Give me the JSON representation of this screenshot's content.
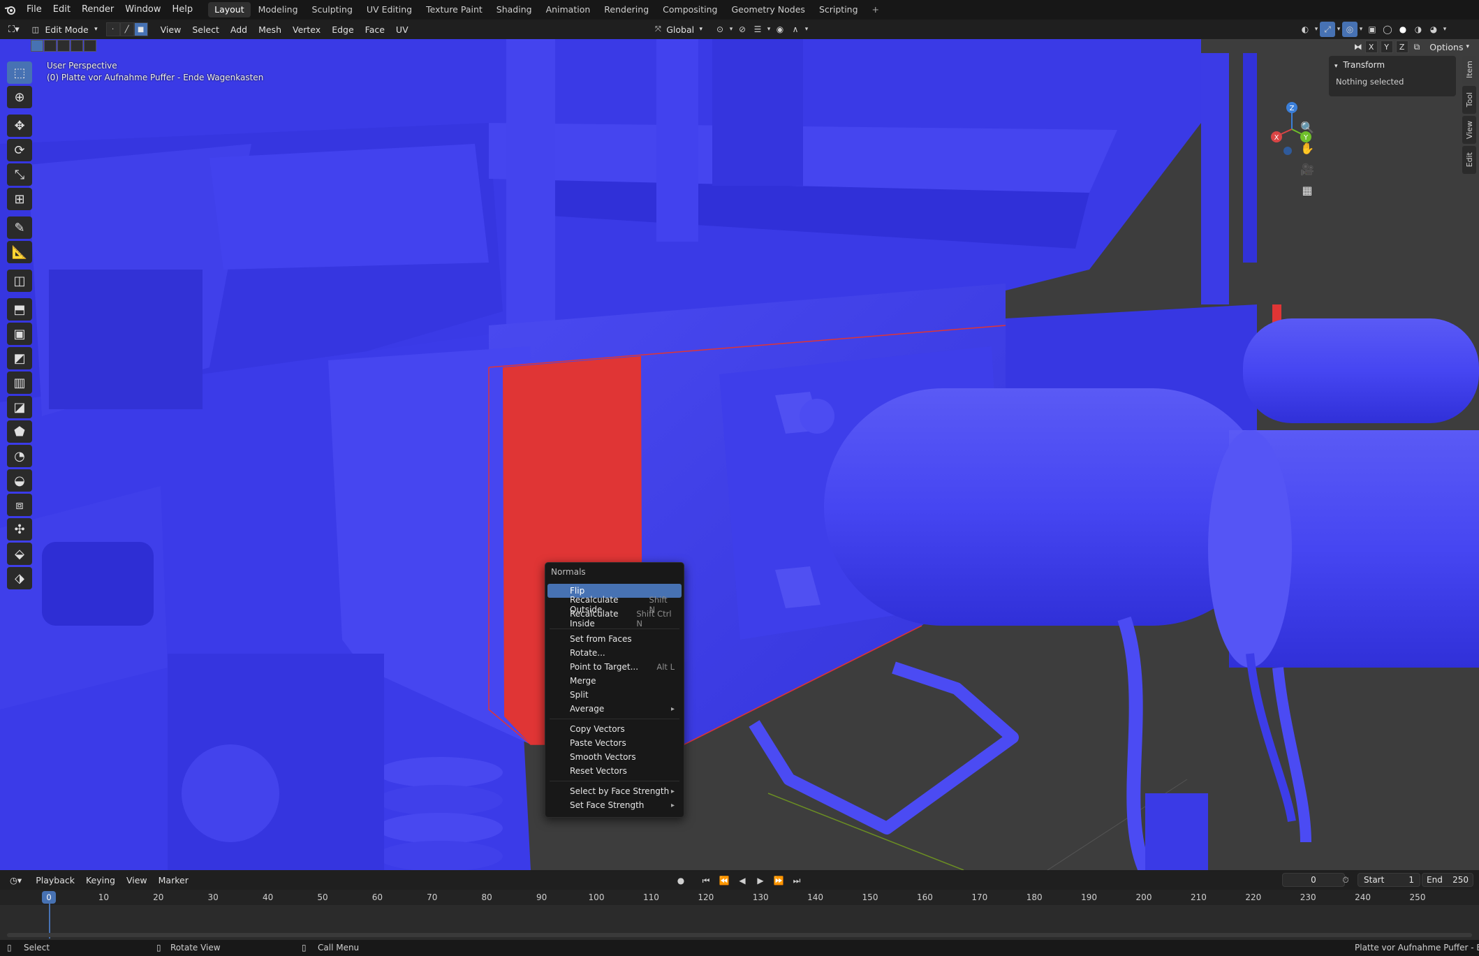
{
  "topbar": {
    "menu": [
      "File",
      "Edit",
      "Render",
      "Window",
      "Help"
    ],
    "workspaces": [
      "Layout",
      "Modeling",
      "Sculpting",
      "UV Editing",
      "Texture Paint",
      "Shading",
      "Animation",
      "Rendering",
      "Compositing",
      "Geometry Nodes",
      "Scripting"
    ],
    "active_workspace": "Layout",
    "add_tab": "+"
  },
  "viewport_header": {
    "mode": "Edit Mode",
    "menus": [
      "View",
      "Select",
      "Add",
      "Mesh",
      "Vertex",
      "Edge",
      "Face",
      "UV"
    ],
    "orientation": "Global",
    "options_label": "Options",
    "axes": [
      "X",
      "Y",
      "Z"
    ]
  },
  "viewport": {
    "perspective": "User Perspective",
    "object_info": "(0) Platte vor Aufnahme Puffer - Ende Wagenkasten",
    "gizmo_axes": [
      "Z",
      "X",
      "Y"
    ],
    "colors": {
      "mesh_blue": "#3b3bf0",
      "face_red": "#e03535",
      "background": "#3a3a3a",
      "accent": "#4772b3"
    }
  },
  "sidebar": {
    "panel_title": "Transform",
    "panel_body": "Nothing selected",
    "tabs": [
      "Item",
      "Tool",
      "View",
      "Edit"
    ]
  },
  "context_menu": {
    "title": "Normals",
    "groups": [
      [
        {
          "label": "Flip",
          "shortcut": "",
          "highlighted": true
        },
        {
          "label": "Recalculate Outside",
          "shortcut": "Shift N"
        },
        {
          "label": "Recalculate Inside",
          "shortcut": "Shift Ctrl N"
        }
      ],
      [
        {
          "label": "Set from Faces",
          "shortcut": ""
        },
        {
          "label": "Rotate...",
          "shortcut": ""
        },
        {
          "label": "Point to Target...",
          "shortcut": "Alt L"
        },
        {
          "label": "Merge",
          "shortcut": ""
        },
        {
          "label": "Split",
          "shortcut": ""
        },
        {
          "label": "Average",
          "shortcut": "",
          "submenu": true
        }
      ],
      [
        {
          "label": "Copy Vectors",
          "shortcut": ""
        },
        {
          "label": "Paste Vectors",
          "shortcut": ""
        },
        {
          "label": "Smooth Vectors",
          "shortcut": ""
        },
        {
          "label": "Reset Vectors",
          "shortcut": ""
        }
      ],
      [
        {
          "label": "Select by Face Strength",
          "shortcut": "",
          "submenu": true
        },
        {
          "label": "Set Face Strength",
          "shortcut": "",
          "submenu": true
        }
      ]
    ]
  },
  "timeline": {
    "menus": [
      "Playback",
      "Keying",
      "View",
      "Marker"
    ],
    "current_frame": "0",
    "start_label": "Start",
    "start_value": "1",
    "end_label": "End",
    "end_value": "250",
    "ruler_marks": [
      "0",
      "10",
      "20",
      "30",
      "40",
      "50",
      "60",
      "70",
      "80",
      "90",
      "100",
      "110",
      "120",
      "130",
      "140",
      "150",
      "160",
      "170",
      "180",
      "190",
      "200",
      "210",
      "220",
      "230",
      "240",
      "250"
    ]
  },
  "statusbar": {
    "select": "Select",
    "rotate": "Rotate View",
    "call_menu": "Call Menu",
    "right_text": "Platte vor Aufnahme Puffer - Ende W"
  }
}
